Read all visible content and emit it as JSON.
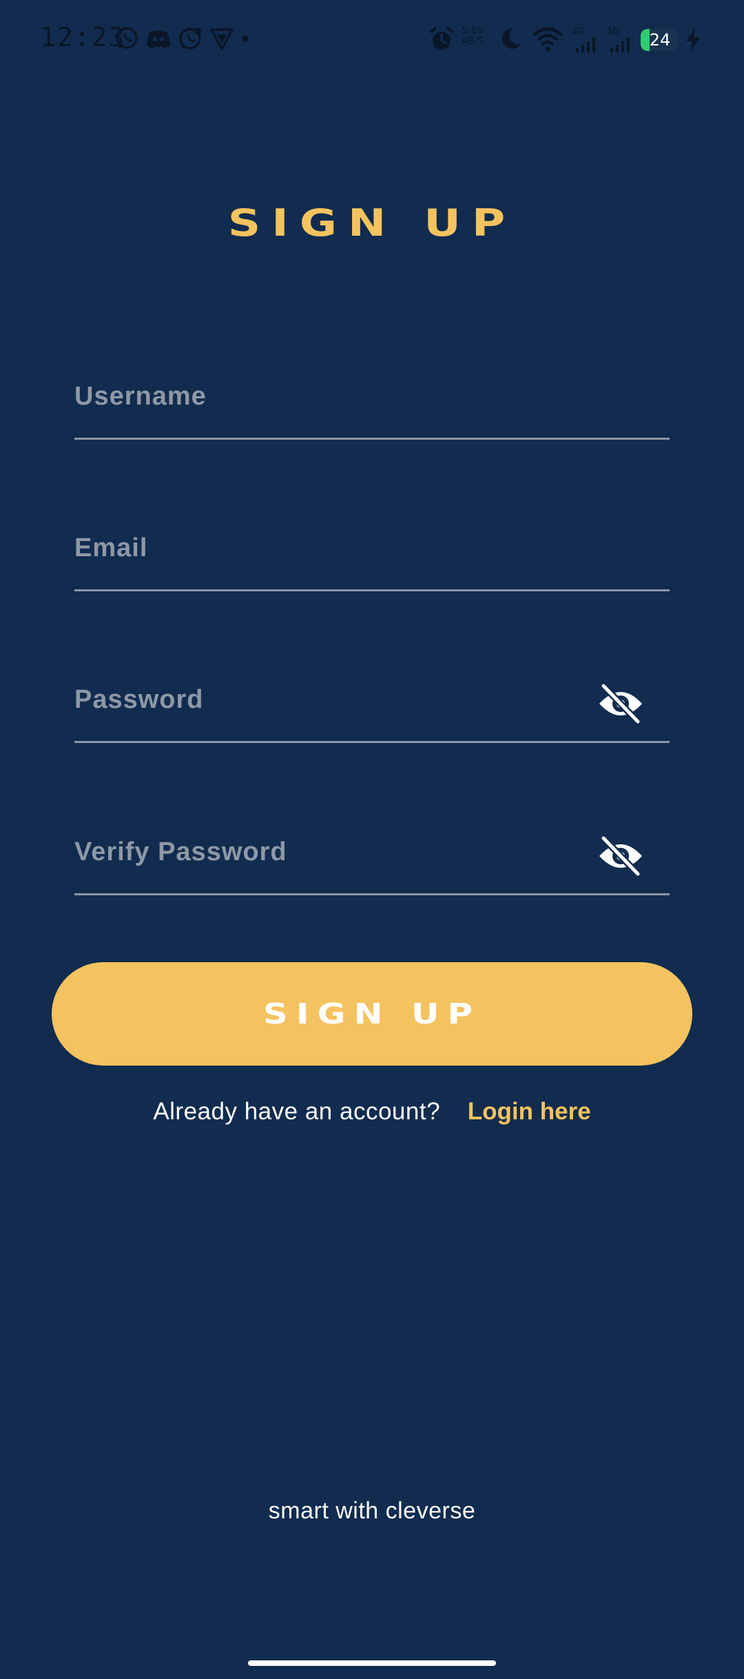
{
  "status_bar": {
    "time": "12:23",
    "network_speed_value": "5.69",
    "network_speed_unit": "KB/S",
    "network_type_1": "4G",
    "network_type_2": "4G",
    "battery_level": "24",
    "battery_fraction": 0.24,
    "left_icons": [
      "whatsapp-icon",
      "discord-icon",
      "whatsapp-business-icon",
      "vpn-icon",
      "notification-dot-icon"
    ],
    "right_icons": [
      "alarm-icon",
      "moon-icon",
      "wifi-icon",
      "cellular-signal-icon",
      "cellular-signal-icon",
      "battery-icon",
      "charging-bolt-icon"
    ]
  },
  "page": {
    "title": "SIGN UP"
  },
  "form": {
    "username_placeholder": "Username",
    "email_placeholder": "Email",
    "password_placeholder": "Password",
    "verify_password_placeholder": "Verify Password",
    "visibility_icon": "eye-off-icon"
  },
  "signup_button_label": "SIGN UP",
  "login_prompt": {
    "text": "Already have an account?",
    "link_label": "Login here"
  },
  "footer": {
    "tagline": "smart with cleverse"
  },
  "colors": {
    "background": "#112c4f",
    "accent": "#f4c35f",
    "placeholder": "#8e98a6",
    "underline": "#8c97a6",
    "text": "#ffffff"
  }
}
